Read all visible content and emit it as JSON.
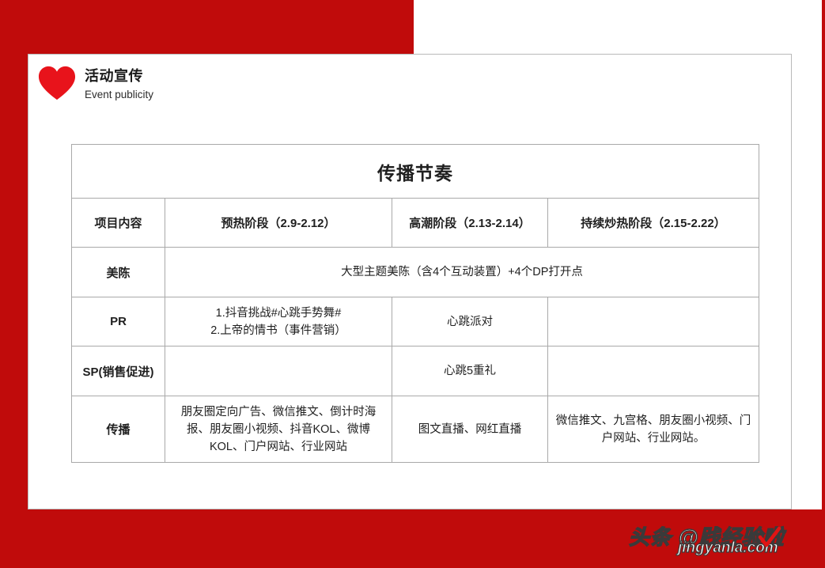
{
  "slide": {
    "accent_red": "#C00B0B",
    "heart_red": "#E8131B"
  },
  "heading": {
    "icon": "heart-icon",
    "title_cn": "活动宣传",
    "title_en": "Event publicity"
  },
  "table": {
    "title": "传播节奏",
    "columns": [
      "项目内容",
      "预热阶段（2.9-2.12）",
      "高潮阶段（2.13-2.14）",
      "持续炒热阶段（2.15-2.22）"
    ],
    "rows": [
      {
        "label": "美陈",
        "merged": true,
        "merged_text": "大型主题美陈（含4个互动装置）+4个DP打开点"
      },
      {
        "label": "PR",
        "merged": false,
        "cells": [
          "1.抖音挑战#心跳手势舞#\n2.上帝的情书（事件营销）",
          "心跳派对",
          ""
        ]
      },
      {
        "label": "SP(销售促进)",
        "merged": false,
        "cells": [
          "",
          "心跳5重礼",
          ""
        ]
      },
      {
        "label": "传播",
        "merged": false,
        "cells": [
          "朋友圈定向广告、微信推文、倒计时海报、朋友圈小视频、抖音KOL、微博KOL、门户网站、行业网站",
          "图文直播、网红直播",
          "微信推文、九宫格、朋友圈小视频、门户网站、行业网站。"
        ]
      }
    ]
  },
  "watermark": {
    "main_text": "头条 @践经验啦",
    "sub_text": "jingyanla.com",
    "check_color": "#E01414"
  }
}
